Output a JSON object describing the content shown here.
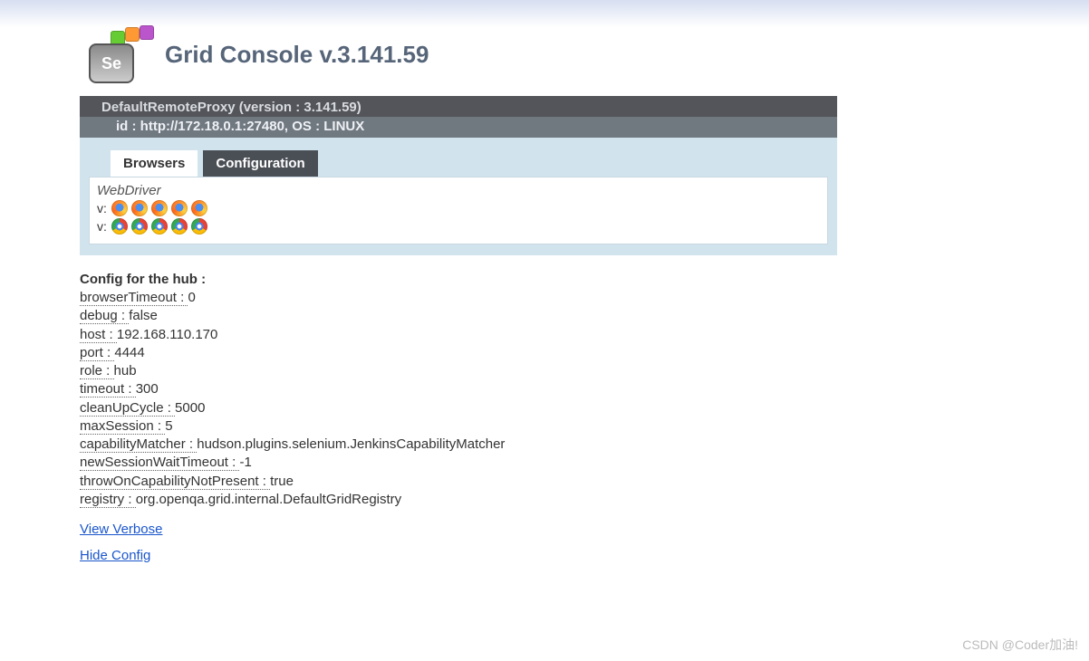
{
  "header": {
    "logo_text": "Se",
    "title": "Grid Console v.3.141.59"
  },
  "proxy": {
    "line1": "DefaultRemoteProxy (version : 3.141.59)",
    "line2": "id : http://172.18.0.1:27480, OS : LINUX",
    "tabs": {
      "browsers": "Browsers",
      "configuration": "Configuration"
    },
    "browsers": {
      "protocol_label": "WebDriver",
      "rows": [
        {
          "prefix": "v:",
          "type": "firefox",
          "count": 5
        },
        {
          "prefix": "v:",
          "type": "chrome",
          "count": 5
        }
      ]
    }
  },
  "hub": {
    "title": "Config for the hub :",
    "items": [
      {
        "key": "browserTimeout : ",
        "val": "0"
      },
      {
        "key": "debug : ",
        "val": "false"
      },
      {
        "key": "host : ",
        "val": "192.168.110.170"
      },
      {
        "key": "port : ",
        "val": "4444"
      },
      {
        "key": "role : ",
        "val": "hub"
      },
      {
        "key": "timeout : ",
        "val": "300"
      },
      {
        "key": "cleanUpCycle : ",
        "val": "5000"
      },
      {
        "key": "maxSession : ",
        "val": "5"
      },
      {
        "key": "capabilityMatcher : ",
        "val": "hudson.plugins.selenium.JenkinsCapabilityMatcher"
      },
      {
        "key": "newSessionWaitTimeout : ",
        "val": "-1"
      },
      {
        "key": "throwOnCapabilityNotPresent : ",
        "val": "true"
      },
      {
        "key": "registry : ",
        "val": "org.openqa.grid.internal.DefaultGridRegistry"
      }
    ]
  },
  "links": {
    "verbose": "View Verbose",
    "hide": "Hide Config"
  },
  "watermark": "CSDN @Coder加油!"
}
